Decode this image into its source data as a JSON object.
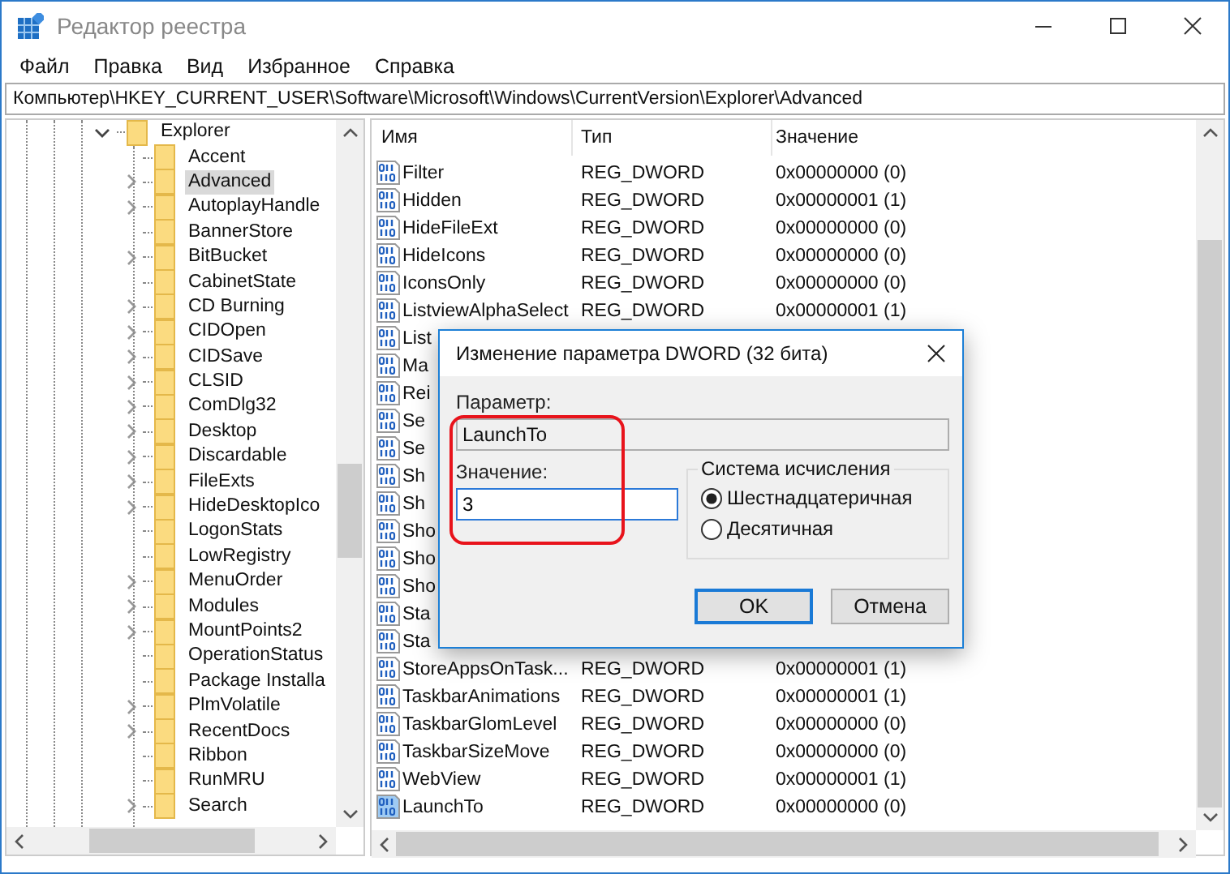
{
  "window": {
    "title": "Редактор реестра"
  },
  "menu": [
    "Файл",
    "Правка",
    "Вид",
    "Избранное",
    "Справка"
  ],
  "address": "Компьютер\\HKEY_CURRENT_USER\\Software\\Microsoft\\Windows\\CurrentVersion\\Explorer\\Advanced",
  "tree": {
    "label": "Explorer",
    "expanded": true,
    "children": [
      {
        "label": "Accent",
        "expandable": false,
        "selected": false
      },
      {
        "label": "Advanced",
        "expandable": true,
        "selected": true
      },
      {
        "label": "AutoplayHandle",
        "expandable": true,
        "selected": false
      },
      {
        "label": "BannerStore",
        "expandable": false,
        "selected": false
      },
      {
        "label": "BitBucket",
        "expandable": true,
        "selected": false
      },
      {
        "label": "CabinetState",
        "expandable": false,
        "selected": false
      },
      {
        "label": "CD Burning",
        "expandable": true,
        "selected": false
      },
      {
        "label": "CIDOpen",
        "expandable": true,
        "selected": false
      },
      {
        "label": "CIDSave",
        "expandable": true,
        "selected": false
      },
      {
        "label": "CLSID",
        "expandable": true,
        "selected": false
      },
      {
        "label": "ComDlg32",
        "expandable": true,
        "selected": false
      },
      {
        "label": "Desktop",
        "expandable": true,
        "selected": false
      },
      {
        "label": "Discardable",
        "expandable": true,
        "selected": false
      },
      {
        "label": "FileExts",
        "expandable": true,
        "selected": false
      },
      {
        "label": "HideDesktopIco",
        "expandable": true,
        "selected": false
      },
      {
        "label": "LogonStats",
        "expandable": false,
        "selected": false
      },
      {
        "label": "LowRegistry",
        "expandable": false,
        "selected": false
      },
      {
        "label": "MenuOrder",
        "expandable": true,
        "selected": false
      },
      {
        "label": "Modules",
        "expandable": true,
        "selected": false
      },
      {
        "label": "MountPoints2",
        "expandable": true,
        "selected": false
      },
      {
        "label": "OperationStatus",
        "expandable": false,
        "selected": false
      },
      {
        "label": "Package Installa",
        "expandable": false,
        "selected": false
      },
      {
        "label": "PlmVolatile",
        "expandable": true,
        "selected": false
      },
      {
        "label": "RecentDocs",
        "expandable": true,
        "selected": false
      },
      {
        "label": "Ribbon",
        "expandable": false,
        "selected": false
      },
      {
        "label": "RunMRU",
        "expandable": false,
        "selected": false
      },
      {
        "label": "Search",
        "expandable": true,
        "selected": false
      }
    ]
  },
  "table": {
    "columns": [
      "Имя",
      "Тип",
      "Значение"
    ],
    "rows": [
      {
        "name": "Filter",
        "type": "REG_DWORD",
        "value": "0x00000000 (0)",
        "selected": false
      },
      {
        "name": "Hidden",
        "type": "REG_DWORD",
        "value": "0x00000001 (1)",
        "selected": false
      },
      {
        "name": "HideFileExt",
        "type": "REG_DWORD",
        "value": "0x00000000 (0)",
        "selected": false
      },
      {
        "name": "HideIcons",
        "type": "REG_DWORD",
        "value": "0x00000000 (0)",
        "selected": false
      },
      {
        "name": "IconsOnly",
        "type": "REG_DWORD",
        "value": "0x00000000 (0)",
        "selected": false
      },
      {
        "name": "ListviewAlphaSelect",
        "type": "REG_DWORD",
        "value": "0x00000001 (1)",
        "selected": false
      },
      {
        "name": "List",
        "selected": false
      },
      {
        "name": "Ma",
        "selected": false
      },
      {
        "name": "Rei",
        "selected": false
      },
      {
        "name": "Se",
        "selected": false
      },
      {
        "name": "Se",
        "selected": false
      },
      {
        "name": "Sh",
        "selected": false
      },
      {
        "name": "Sh",
        "selected": false
      },
      {
        "name": "Sho",
        "selected": false
      },
      {
        "name": "Sho",
        "selected": false
      },
      {
        "name": "Sho",
        "selected": false
      },
      {
        "name": "Sta",
        "selected": false
      },
      {
        "name": "Sta",
        "selected": false
      },
      {
        "name": "StoreAppsOnTask...",
        "type": "REG_DWORD",
        "value": "0x00000001 (1)",
        "selected": false
      },
      {
        "name": "TaskbarAnimations",
        "type": "REG_DWORD",
        "value": "0x00000001 (1)",
        "selected": false
      },
      {
        "name": "TaskbarGlomLevel",
        "type": "REG_DWORD",
        "value": "0x00000000 (0)",
        "selected": false
      },
      {
        "name": "TaskbarSizeMove",
        "type": "REG_DWORD",
        "value": "0x00000000 (0)",
        "selected": false
      },
      {
        "name": "WebView",
        "type": "REG_DWORD",
        "value": "0x00000001 (1)",
        "selected": false
      },
      {
        "name": "LaunchTo",
        "type": "REG_DWORD",
        "value": "0x00000000 (0)",
        "selected": true
      }
    ]
  },
  "dialog": {
    "title": "Изменение параметра DWORD (32 бита)",
    "name_label": "Параметр:",
    "name_value": "LaunchTo",
    "value_label": "Значение:",
    "value": "3",
    "base_title": "Система исчисления",
    "bases": [
      {
        "label": "Шестнадцатеричная",
        "selected": true
      },
      {
        "label": "Десятичная",
        "selected": false
      }
    ],
    "buttons": [
      {
        "label": "OK",
        "default": true
      },
      {
        "label": "Отмена",
        "default": false
      }
    ]
  }
}
